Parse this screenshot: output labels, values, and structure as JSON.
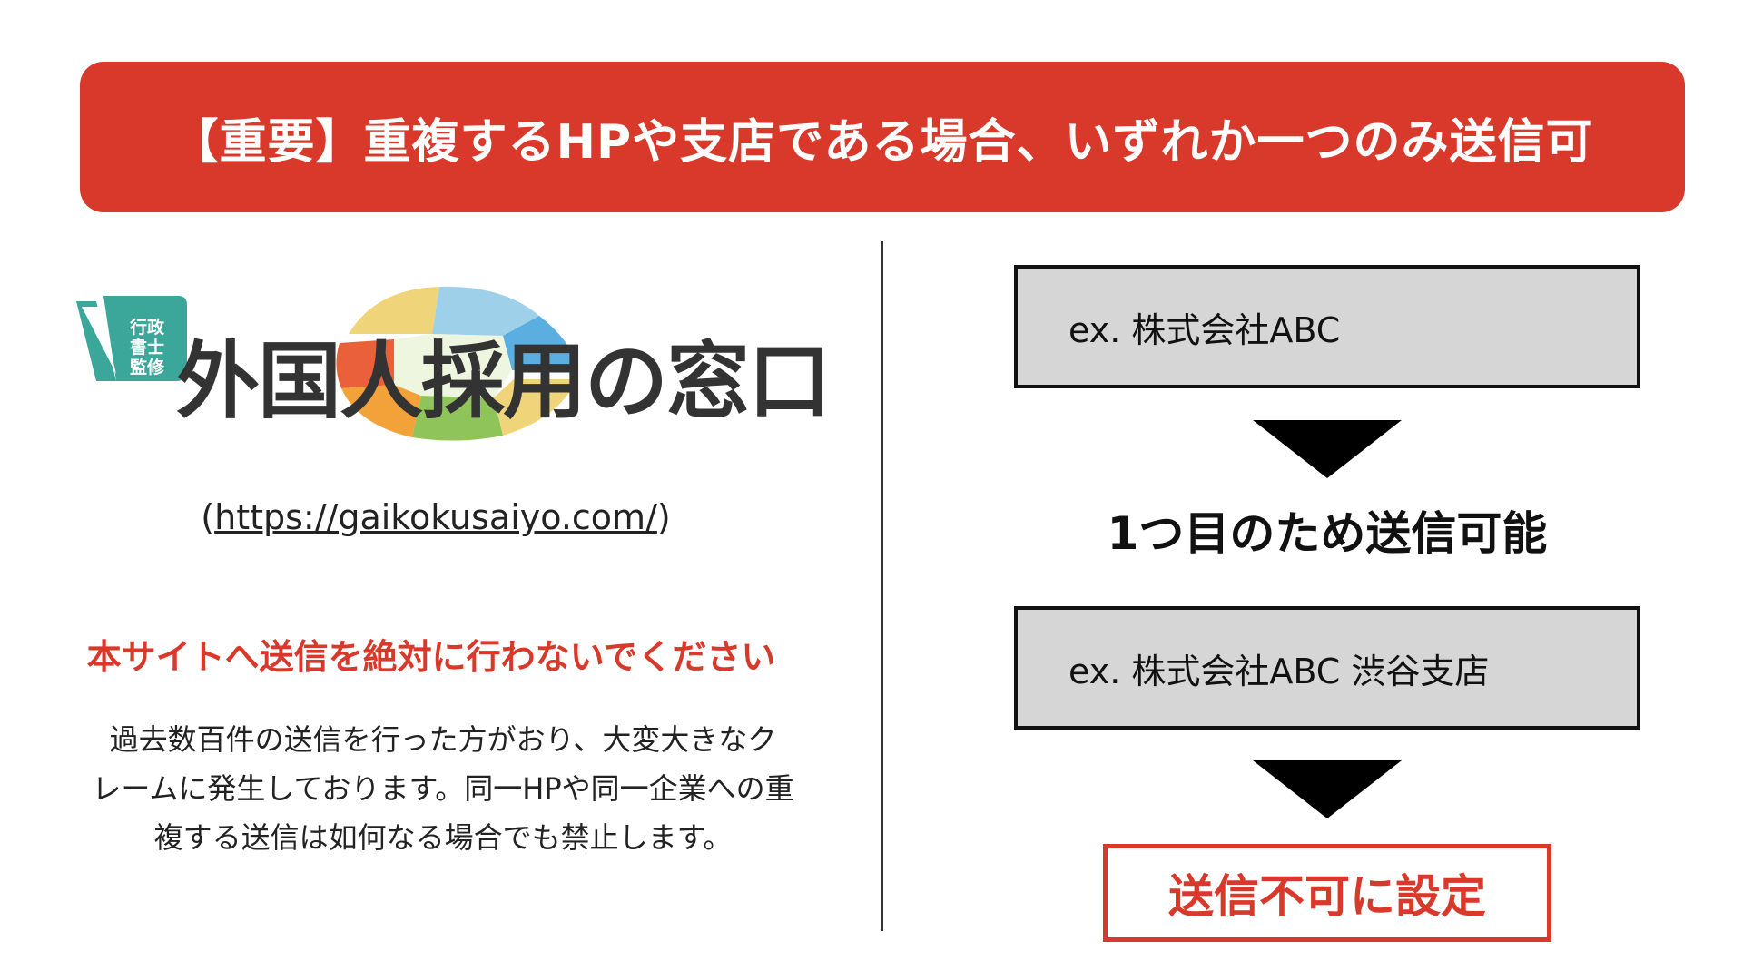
{
  "banner": {
    "text": "【重要】重複するHPや支店である場合、いずれか一つのみ送信可",
    "color": "#d8392b"
  },
  "logo": {
    "badge_lines": [
      "行政",
      "書士",
      "監修"
    ],
    "title": "外国人採用の窓口",
    "icon": "globe-logo-icon"
  },
  "url": {
    "open_paren": "(",
    "link": "https://gaikokusaiyo.com/",
    "close_paren": ")"
  },
  "warning": {
    "text": "本サイトへ送信を絶対に行わないでください",
    "color": "#d8392b"
  },
  "description": {
    "lines": [
      "過去数百件の送信を行った方がおり、大変大きなク",
      "レームに発生しております。同一HPや同一企業への重",
      "複する送信は如何なる場合でも禁止します。"
    ]
  },
  "flow": {
    "example1": "ex. 株式会社ABC",
    "result1": "1つ目のため送信可能",
    "example2": "ex. 株式会社ABC 渋谷支店",
    "result2": "送信不可に設定"
  }
}
